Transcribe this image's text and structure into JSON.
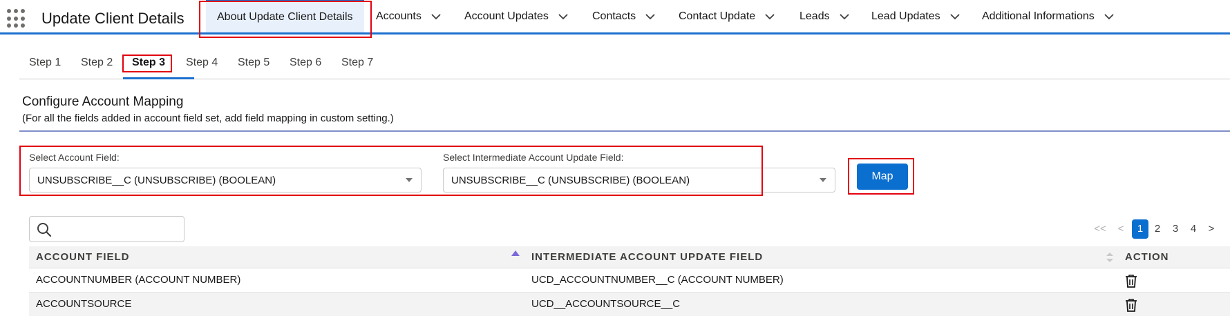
{
  "app": {
    "title": "Update Client Details"
  },
  "nav": {
    "items": [
      {
        "label": "About Update Client Details"
      },
      {
        "label": "Accounts"
      },
      {
        "label": "Account Updates"
      },
      {
        "label": "Contacts"
      },
      {
        "label": "Contact Update"
      },
      {
        "label": "Leads"
      },
      {
        "label": "Lead Updates"
      },
      {
        "label": "Additional Informations"
      }
    ],
    "active": "About Update Client Details"
  },
  "steps": {
    "items": [
      "Step 1",
      "Step 2",
      "Step 3",
      "Step 4",
      "Step 5",
      "Step 6",
      "Step 7"
    ],
    "active": "Step 3"
  },
  "section": {
    "title": "Configure Account Mapping",
    "subtitle": "(For all the fields added in account field set, add field mapping in custom setting.)"
  },
  "form": {
    "account_field_label": "Select Account Field:",
    "account_field_value": "UNSUBSCRIBE__C (UNSUBSCRIBE) (BOOLEAN)",
    "intermediate_field_label": "Select Intermediate Account Update Field:",
    "intermediate_field_value": "UNSUBSCRIBE__C (UNSUBSCRIBE) (BOOLEAN)",
    "map_button": "Map"
  },
  "search": {
    "placeholder": ""
  },
  "pager": {
    "first": "<<",
    "prev": "<",
    "pages": [
      "1",
      "2",
      "3",
      "4"
    ],
    "current": "1",
    "next": ">"
  },
  "table": {
    "headers": [
      "ACCOUNT FIELD",
      "INTERMEDIATE ACCOUNT UPDATE FIELD",
      "ACTION"
    ],
    "rows": [
      [
        "ACCOUNTNUMBER (ACCOUNT NUMBER)",
        "UCD_ACCOUNTNUMBER__C (ACCOUNT NUMBER)"
      ],
      [
        "ACCOUNTSOURCE",
        "UCD__ACCOUNTSOURCE__C"
      ]
    ]
  },
  "colors": {
    "accent": "#1b6fce",
    "highlight": "#e3000f",
    "button": "#0b6fd0"
  }
}
